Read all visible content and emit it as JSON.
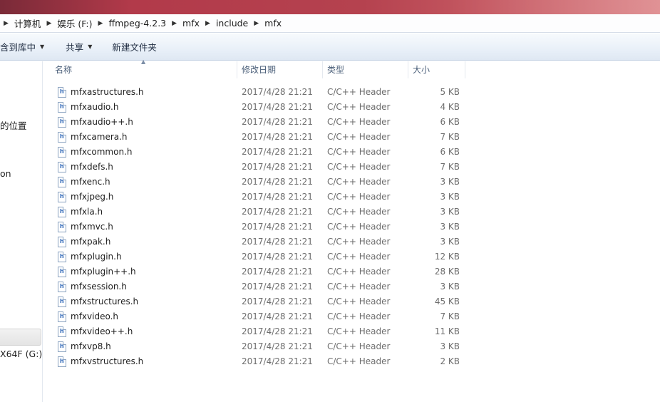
{
  "breadcrumb": [
    "计算机",
    "娱乐 (F:)",
    "ffmpeg-4.2.3",
    "mfx",
    "include",
    "mfx"
  ],
  "toolbar": {
    "include_library": "含到库中",
    "share": "共享",
    "new_folder": "新建文件夹"
  },
  "nav": {
    "item_location": "的位置",
    "item_on": "on",
    "item_drive": "X64F (G:)"
  },
  "columns": {
    "name": "名称",
    "date": "修改日期",
    "type": "类型",
    "size": "大小"
  },
  "file_icon_glyph": "h",
  "files": [
    {
      "name": "mfxastructures.h",
      "date": "2017/4/28 21:21",
      "type": "C/C++ Header",
      "size": "5 KB"
    },
    {
      "name": "mfxaudio.h",
      "date": "2017/4/28 21:21",
      "type": "C/C++ Header",
      "size": "4 KB"
    },
    {
      "name": "mfxaudio++.h",
      "date": "2017/4/28 21:21",
      "type": "C/C++ Header",
      "size": "6 KB"
    },
    {
      "name": "mfxcamera.h",
      "date": "2017/4/28 21:21",
      "type": "C/C++ Header",
      "size": "7 KB"
    },
    {
      "name": "mfxcommon.h",
      "date": "2017/4/28 21:21",
      "type": "C/C++ Header",
      "size": "6 KB"
    },
    {
      "name": "mfxdefs.h",
      "date": "2017/4/28 21:21",
      "type": "C/C++ Header",
      "size": "7 KB"
    },
    {
      "name": "mfxenc.h",
      "date": "2017/4/28 21:21",
      "type": "C/C++ Header",
      "size": "3 KB"
    },
    {
      "name": "mfxjpeg.h",
      "date": "2017/4/28 21:21",
      "type": "C/C++ Header",
      "size": "3 KB"
    },
    {
      "name": "mfxla.h",
      "date": "2017/4/28 21:21",
      "type": "C/C++ Header",
      "size": "3 KB"
    },
    {
      "name": "mfxmvc.h",
      "date": "2017/4/28 21:21",
      "type": "C/C++ Header",
      "size": "3 KB"
    },
    {
      "name": "mfxpak.h",
      "date": "2017/4/28 21:21",
      "type": "C/C++ Header",
      "size": "3 KB"
    },
    {
      "name": "mfxplugin.h",
      "date": "2017/4/28 21:21",
      "type": "C/C++ Header",
      "size": "12 KB"
    },
    {
      "name": "mfxplugin++.h",
      "date": "2017/4/28 21:21",
      "type": "C/C++ Header",
      "size": "28 KB"
    },
    {
      "name": "mfxsession.h",
      "date": "2017/4/28 21:21",
      "type": "C/C++ Header",
      "size": "3 KB"
    },
    {
      "name": "mfxstructures.h",
      "date": "2017/4/28 21:21",
      "type": "C/C++ Header",
      "size": "45 KB"
    },
    {
      "name": "mfxvideo.h",
      "date": "2017/4/28 21:21",
      "type": "C/C++ Header",
      "size": "7 KB"
    },
    {
      "name": "mfxvideo++.h",
      "date": "2017/4/28 21:21",
      "type": "C/C++ Header",
      "size": "11 KB"
    },
    {
      "name": "mfxvp8.h",
      "date": "2017/4/28 21:21",
      "type": "C/C++ Header",
      "size": "3 KB"
    },
    {
      "name": "mfxvstructures.h",
      "date": "2017/4/28 21:21",
      "type": "C/C++ Header",
      "size": "2 KB"
    }
  ]
}
